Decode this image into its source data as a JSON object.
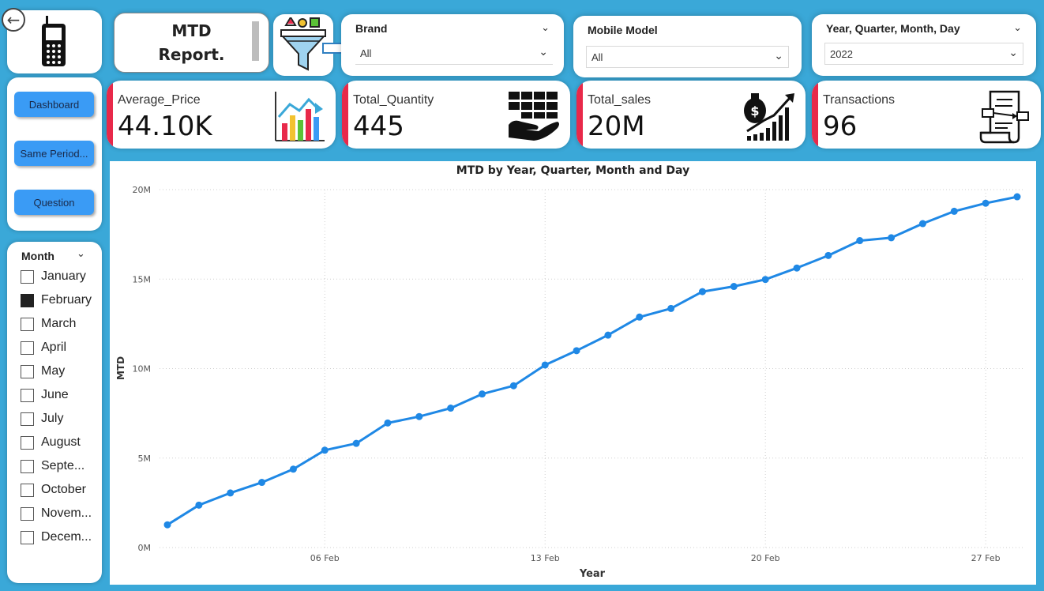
{
  "header": {
    "title_line1": "MTD",
    "title_line2": "Report."
  },
  "slicers": {
    "brand": {
      "label": "Brand",
      "value": "All"
    },
    "model": {
      "label": "Mobile Model",
      "value": "All"
    },
    "date": {
      "label": "Year, Quarter, Month, Day",
      "value": "2022"
    }
  },
  "nav": {
    "dashboard": "Dashboard",
    "same_period": "Same Period...",
    "question": "Question"
  },
  "month_slicer": {
    "label": "Month",
    "items": [
      {
        "label": "January",
        "checked": false
      },
      {
        "label": "February",
        "checked": true
      },
      {
        "label": "March",
        "checked": false
      },
      {
        "label": "April",
        "checked": false
      },
      {
        "label": "May",
        "checked": false
      },
      {
        "label": "June",
        "checked": false
      },
      {
        "label": "July",
        "checked": false
      },
      {
        "label": "August",
        "checked": false
      },
      {
        "label": "Septe...",
        "checked": false
      },
      {
        "label": "October",
        "checked": false
      },
      {
        "label": "Novem...",
        "checked": false
      },
      {
        "label": "Decem...",
        "checked": false
      }
    ]
  },
  "kpis": [
    {
      "label": "Average_Price",
      "value": "44.10K",
      "icon": "bar-chart-icon"
    },
    {
      "label": "Total_Quantity",
      "value": "445",
      "icon": "hand-boxes-icon"
    },
    {
      "label": "Total_sales",
      "value": "20M",
      "icon": "money-growth-icon"
    },
    {
      "label": "Transactions",
      "value": "96",
      "icon": "receipt-icon"
    }
  ],
  "colors": {
    "background": "#3aa8d8",
    "accent": "#e8294a",
    "button": "#3a9bf5",
    "line": "#1f88e5"
  },
  "chart_data": {
    "type": "line",
    "title": "MTD by Year, Quarter, Month and Day",
    "xlabel": "Year",
    "ylabel": "MTD",
    "x_ticks": [
      "06 Feb",
      "13 Feb",
      "20 Feb",
      "27 Feb"
    ],
    "y_ticks": [
      "0M",
      "5M",
      "10M",
      "15M",
      "20M"
    ],
    "ylim": [
      0,
      20000000
    ],
    "x": [
      "2022-02-01",
      "2022-02-02",
      "2022-02-03",
      "2022-02-04",
      "2022-02-05",
      "2022-02-06",
      "2022-02-07",
      "2022-02-08",
      "2022-02-09",
      "2022-02-10",
      "2022-02-11",
      "2022-02-12",
      "2022-02-13",
      "2022-02-14",
      "2022-02-15",
      "2022-02-16",
      "2022-02-17",
      "2022-02-18",
      "2022-02-19",
      "2022-02-20",
      "2022-02-21",
      "2022-02-22",
      "2022-02-23",
      "2022-02-24",
      "2022-02-25",
      "2022-02-26",
      "2022-02-27",
      "2022-02-28"
    ],
    "series": [
      {
        "values": [
          1270000,
          2370000,
          3050000,
          3640000,
          4380000,
          5440000,
          5820000,
          6960000,
          7320000,
          7790000,
          8580000,
          9040000,
          10200000,
          11000000,
          11870000,
          12880000,
          13360000,
          14300000,
          14590000,
          14980000,
          15620000,
          16320000,
          17150000,
          17310000,
          18100000,
          18790000,
          19240000,
          19600000
        ]
      }
    ],
    "grid": true
  }
}
